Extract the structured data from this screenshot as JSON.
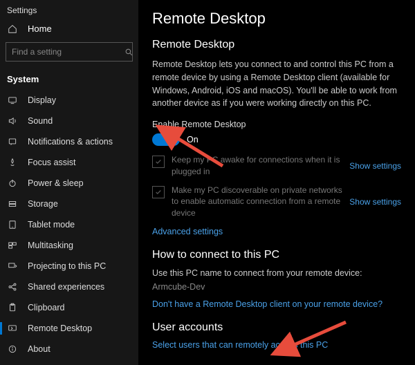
{
  "window": {
    "title": "Settings"
  },
  "sidebar": {
    "home": "Home",
    "search_placeholder": "Find a setting",
    "section": "System",
    "items": [
      {
        "label": "Display"
      },
      {
        "label": "Sound"
      },
      {
        "label": "Notifications & actions"
      },
      {
        "label": "Focus assist"
      },
      {
        "label": "Power & sleep"
      },
      {
        "label": "Storage"
      },
      {
        "label": "Tablet mode"
      },
      {
        "label": "Multitasking"
      },
      {
        "label": "Projecting to this PC"
      },
      {
        "label": "Shared experiences"
      },
      {
        "label": "Clipboard"
      },
      {
        "label": "Remote Desktop"
      },
      {
        "label": "About"
      }
    ],
    "active_index": 11
  },
  "main": {
    "page_title": "Remote Desktop",
    "section_title": "Remote Desktop",
    "description": "Remote Desktop lets you connect to and control this PC from a remote device by using a Remote Desktop client (available for Windows, Android, iOS and macOS). You'll be able to work from another device as if you were working directly on this PC.",
    "toggle_label": "Enable Remote Desktop",
    "toggle_state": "On",
    "options": [
      {
        "text": "Keep my PC awake for connections when it is plugged in",
        "link": "Show settings"
      },
      {
        "text": "Make my PC discoverable on private networks to enable automatic connection from a remote device",
        "link": "Show settings"
      }
    ],
    "advanced_link": "Advanced settings",
    "howto_title": "How to connect to this PC",
    "howto_line": "Use this PC name to connect from your remote device:",
    "pc_name": "Armcube-Dev",
    "client_link": "Don't have a Remote Desktop client on your remote device?",
    "ua_title": "User accounts",
    "ua_link": "Select users that can remotely access this PC"
  },
  "colors": {
    "accent": "#0078d4",
    "link": "#4aa1e8"
  }
}
